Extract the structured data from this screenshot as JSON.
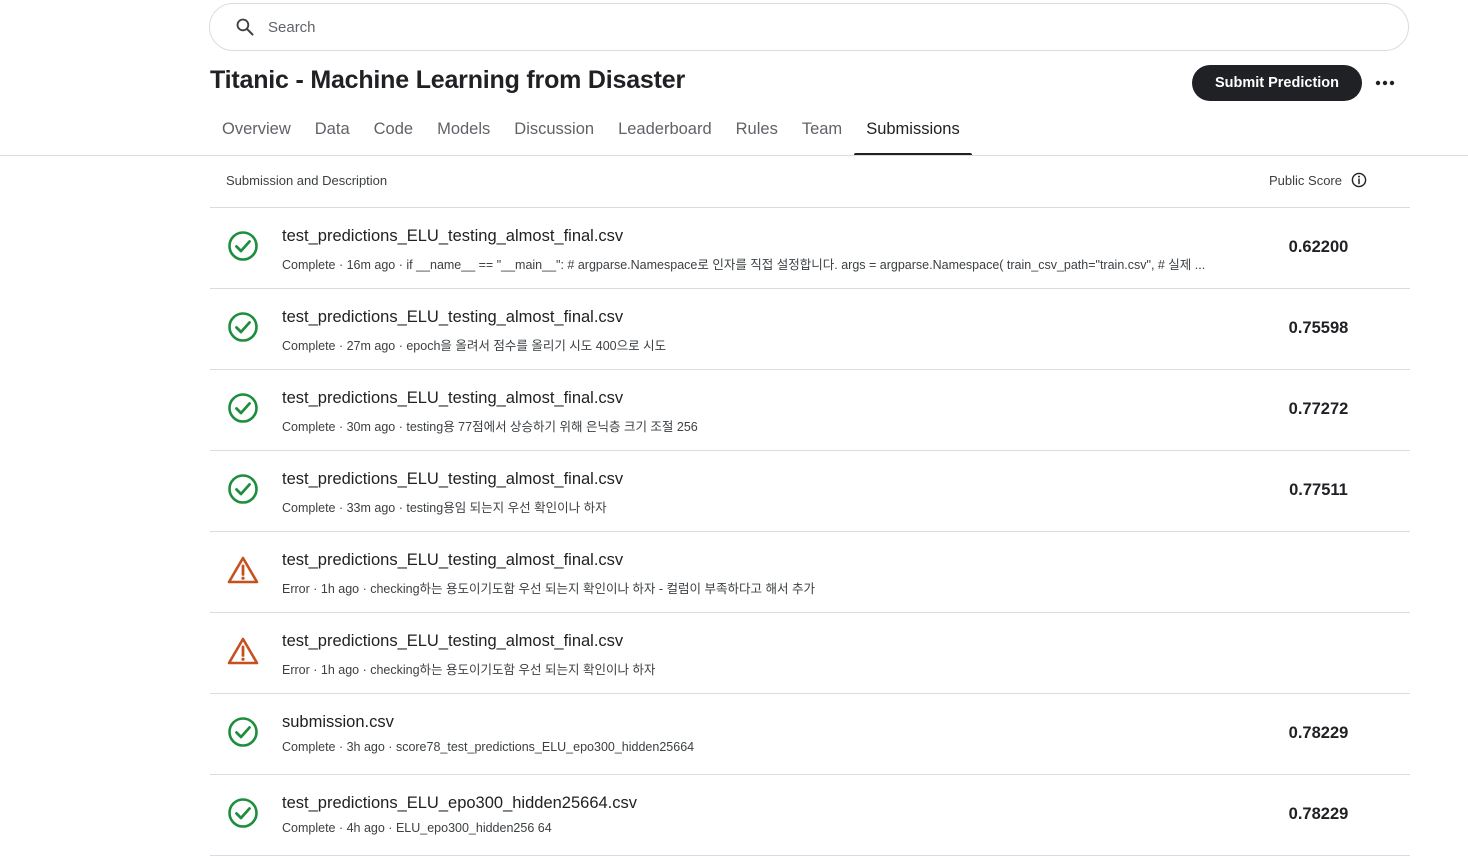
{
  "search": {
    "placeholder": "Search"
  },
  "competition": {
    "title": "Titanic - Machine Learning from Disaster"
  },
  "actions": {
    "submit_label": "Submit Prediction"
  },
  "tabs": [
    {
      "label": "Overview"
    },
    {
      "label": "Data"
    },
    {
      "label": "Code"
    },
    {
      "label": "Models"
    },
    {
      "label": "Discussion"
    },
    {
      "label": "Leaderboard"
    },
    {
      "label": "Rules"
    },
    {
      "label": "Team"
    },
    {
      "label": "Submissions",
      "active": true
    }
  ],
  "table": {
    "col_description": "Submission and Description",
    "col_score": "Public Score"
  },
  "colors": {
    "success": "#1e8e3e",
    "error": "#c5511f",
    "primary_button": "#202124"
  },
  "submissions": [
    {
      "status": "complete",
      "icon": "check-circle-icon",
      "file": "test_predictions_ELU_testing_almost_final.csv",
      "meta": "Complete · 16m ago · if __name__ == \"__main__\": # argparse.Namespace로 인자를 직접 설정합니다. args = argparse.Namespace( train_csv_path=\"train.csv\", # 실제 ...",
      "score": "0.62200"
    },
    {
      "status": "complete",
      "icon": "check-circle-icon",
      "file": "test_predictions_ELU_testing_almost_final.csv",
      "meta": "Complete · 27m ago · epoch을 올려서 점수를 올리기 시도 400으로 시도",
      "score": "0.75598"
    },
    {
      "status": "complete",
      "icon": "check-circle-icon",
      "file": "test_predictions_ELU_testing_almost_final.csv",
      "meta": "Complete · 30m ago · testing용 77점에서 상승하기 위해 은닉층 크기 조절 256",
      "score": "0.77272"
    },
    {
      "status": "complete",
      "icon": "check-circle-icon",
      "file": "test_predictions_ELU_testing_almost_final.csv",
      "meta": "Complete · 33m ago · testing용임 되는지 우선 확인이나 하자",
      "score": "0.77511"
    },
    {
      "status": "error",
      "icon": "warning-triangle-icon",
      "file": "test_predictions_ELU_testing_almost_final.csv",
      "meta": "Error · 1h ago · checking하는 용도이기도함 우선 되는지 확인이나 하자 - 컬럼이 부족하다고 해서 추가",
      "score": ""
    },
    {
      "status": "error",
      "icon": "warning-triangle-icon",
      "file": "test_predictions_ELU_testing_almost_final.csv",
      "meta": "Error · 1h ago · checking하는 용도이기도함 우선 되는지 확인이나 하자",
      "score": ""
    },
    {
      "status": "complete",
      "icon": "check-circle-icon",
      "file": "submission.csv",
      "meta": "Complete · 3h ago · score78_test_predictions_ELU_epo300_hidden25664",
      "score": "0.78229"
    },
    {
      "status": "complete",
      "icon": "check-circle-icon",
      "file": "test_predictions_ELU_epo300_hidden25664.csv",
      "meta": "Complete · 4h ago · ELU_epo300_hidden256 64",
      "score": "0.78229"
    }
  ]
}
